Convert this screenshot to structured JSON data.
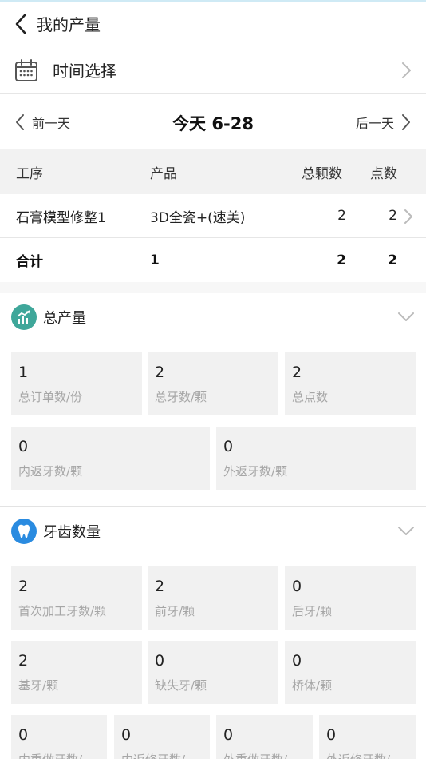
{
  "header": {
    "title": "我的产量"
  },
  "time_select": {
    "label": "时间选择"
  },
  "day_nav": {
    "prev_label": "前一天",
    "today_label": "今天 6-28",
    "next_label": "后一天"
  },
  "table": {
    "headers": [
      "工序",
      "产品",
      "总颗数",
      "点数"
    ],
    "rows": [
      {
        "process": "石膏模型修整1",
        "product": "3D全瓷+(速美)",
        "total_count": "2",
        "points": "2"
      }
    ],
    "total": {
      "label": "合计",
      "product_count": "1",
      "total_count": "2",
      "points": "2"
    }
  },
  "total_output": {
    "title": "总产量",
    "cards": [
      {
        "value": "1",
        "label": "总订单数/份"
      },
      {
        "value": "2",
        "label": "总牙数/颗"
      },
      {
        "value": "2",
        "label": "总点数"
      },
      {
        "value": "0",
        "label": "内返牙数/颗"
      },
      {
        "value": "0",
        "label": "外返牙数/颗"
      }
    ]
  },
  "teeth_count": {
    "title": "牙齿数量",
    "cards": [
      {
        "value": "2",
        "label": "首次加工牙数/颗"
      },
      {
        "value": "2",
        "label": "前牙/颗"
      },
      {
        "value": "0",
        "label": "后牙/颗"
      },
      {
        "value": "2",
        "label": "基牙/颗"
      },
      {
        "value": "0",
        "label": "缺失牙/颗"
      },
      {
        "value": "0",
        "label": "桥体/颗"
      },
      {
        "value": "0",
        "label": "内重做牙数/"
      },
      {
        "value": "0",
        "label": "内返修牙数/"
      },
      {
        "value": "0",
        "label": "外重做牙数/"
      },
      {
        "value": "0",
        "label": "外返修牙数/"
      }
    ]
  },
  "colors": {
    "accent_teal": "#3fa79a",
    "accent_blue": "#2a8be0",
    "card_bg": "#f1f1f1",
    "label_gray": "#a6a6a6"
  }
}
